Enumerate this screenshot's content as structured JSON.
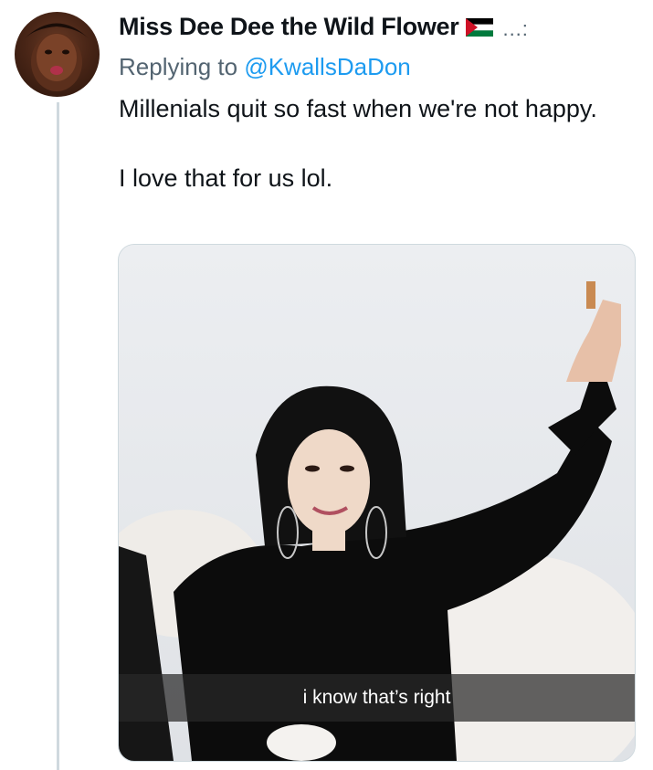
{
  "author": {
    "display_name": "Miss Dee Dee the Wild Flower",
    "flag_icon": "palestine-flag-icon",
    "more_label": "...:"
  },
  "reply_context": {
    "prefix": "Replying to",
    "handle": "@KwallsDaDon"
  },
  "tweet": {
    "line1": "Millenials quit so fast when we're not happy.",
    "line2": "I love that for us lol."
  },
  "media": {
    "caption": "i know that’s right"
  },
  "colors": {
    "link": "#1d9bf0",
    "secondary_text": "#536471",
    "thread_line": "#cfd9de"
  }
}
